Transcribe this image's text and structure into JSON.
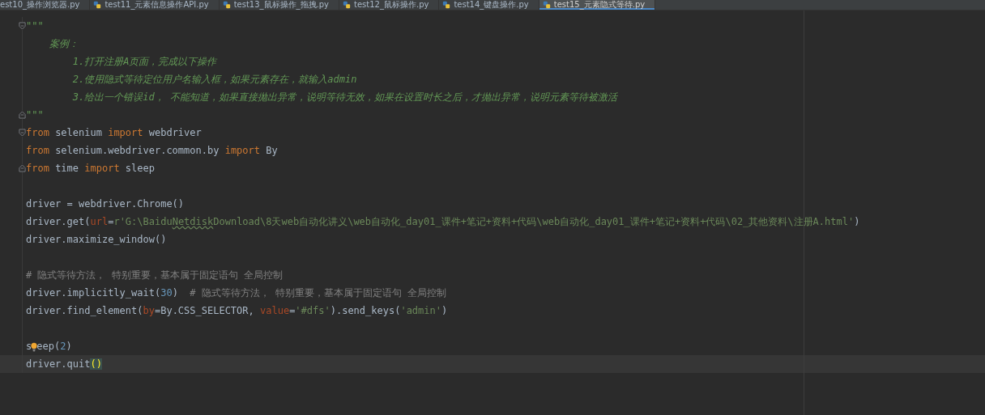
{
  "tabs": [
    {
      "label": "est10_操作浏览器.py",
      "selected": false
    },
    {
      "label": "test11_元素信息操作API.py",
      "selected": false
    },
    {
      "label": "test13_鼠标操作_拖拽.py",
      "selected": false
    },
    {
      "label": "test12_鼠标操作.py",
      "selected": false
    },
    {
      "label": "test14_键盘操作.py",
      "selected": false
    },
    {
      "label": "test15_元素隐式等待.py",
      "selected": true
    }
  ],
  "editor": {
    "lines": [
      {
        "fold_open": true,
        "tokens": [
          {
            "text": "\"\"\"",
            "kind": "doc"
          }
        ]
      },
      {
        "tokens": [
          {
            "text": "    案例：",
            "kind": "doc"
          }
        ]
      },
      {
        "tokens": [
          {
            "text": "        1.打开注册A页面，完成以下操作",
            "kind": "doc"
          }
        ]
      },
      {
        "tokens": [
          {
            "text": "        2.使用隐式等待定位用户名输入框，如果元素存在，就输入admin",
            "kind": "doc"
          }
        ]
      },
      {
        "tokens": [
          {
            "text": "        3.给出一个错误id， 不能知道，如果直接抛出异常，说明等待无效，如果在设置时长之后，才抛出异常，说明元素等待被激活",
            "kind": "doc"
          }
        ]
      },
      {
        "fold_close": true,
        "tokens": [
          {
            "text": "\"\"\"",
            "kind": "doc"
          }
        ]
      },
      {
        "fold_open": true,
        "tokens": [
          {
            "text": "from",
            "kind": "kw"
          },
          {
            "text": " selenium ",
            "kind": "plain"
          },
          {
            "text": "import",
            "kind": "kw"
          },
          {
            "text": " webdriver",
            "kind": "plain"
          }
        ]
      },
      {
        "tokens": [
          {
            "text": "from",
            "kind": "kw"
          },
          {
            "text": " selenium.webdriver.common.by ",
            "kind": "plain"
          },
          {
            "text": "import",
            "kind": "kw"
          },
          {
            "text": " By",
            "kind": "plain"
          }
        ]
      },
      {
        "fold_close": true,
        "tokens": [
          {
            "text": "from",
            "kind": "kw"
          },
          {
            "text": " time ",
            "kind": "plain"
          },
          {
            "text": "import",
            "kind": "kw"
          },
          {
            "text": " sleep",
            "kind": "plain"
          }
        ]
      },
      {
        "blank_line_before": true,
        "tokens": [
          {
            "text": "driver = webdriver.Chrome()",
            "kind": "plain"
          }
        ]
      },
      {
        "tokens": [
          {
            "text": "driver.get(",
            "kind": "plain"
          },
          {
            "text": "url",
            "kind": "param"
          },
          {
            "text": "=",
            "kind": "plain"
          },
          {
            "text": "r'G:\\Baidu",
            "kind": "str"
          },
          {
            "text": "Netdisk",
            "kind": "typo"
          },
          {
            "text": "Download\\8天web自动化讲义\\web自动化_day01_课件+笔记+资料+代码\\web自动化_day01_课件+笔记+资料+代码\\02_其他资料\\注册A.html'",
            "kind": "str"
          },
          {
            "text": ")",
            "kind": "plain"
          }
        ]
      },
      {
        "tokens": [
          {
            "text": "driver.maximize_window()",
            "kind": "plain"
          }
        ]
      },
      {
        "blank_line_before": true,
        "tokens": [
          {
            "text": "# 隐式等待方法， 特别重要，基本属于固定语句 全局控制",
            "kind": "comment"
          }
        ]
      },
      {
        "tokens": [
          {
            "text": "driver.implicitly_wait(",
            "kind": "plain"
          },
          {
            "text": "30",
            "kind": "num"
          },
          {
            "text": ")  ",
            "kind": "plain"
          },
          {
            "text": "# 隐式等待方法， 特别重要，基本属于固定语句 全局控制",
            "kind": "comment"
          }
        ]
      },
      {
        "tokens": [
          {
            "text": "driver.find_element(",
            "kind": "plain"
          },
          {
            "text": "by",
            "kind": "param"
          },
          {
            "text": "=By.CSS_SELECTOR, ",
            "kind": "plain"
          },
          {
            "text": "value",
            "kind": "param"
          },
          {
            "text": "=",
            "kind": "plain"
          },
          {
            "text": "'#dfs'",
            "kind": "str"
          },
          {
            "text": ").send_keys(",
            "kind": "plain"
          },
          {
            "text": "'admin'",
            "kind": "str"
          },
          {
            "text": ")",
            "kind": "plain"
          }
        ]
      },
      {
        "blank_line_before": true,
        "tokens": [
          {
            "text": "s",
            "kind": "plain"
          },
          {
            "kind": "bulb"
          },
          {
            "text": "eep(",
            "kind": "plain"
          },
          {
            "text": "2",
            "kind": "num"
          },
          {
            "text": ")",
            "kind": "plain"
          }
        ]
      },
      {
        "current": true,
        "tokens": [
          {
            "text": "driver.quit",
            "kind": "plain"
          },
          {
            "text": "()",
            "kind": "match"
          }
        ]
      }
    ]
  }
}
